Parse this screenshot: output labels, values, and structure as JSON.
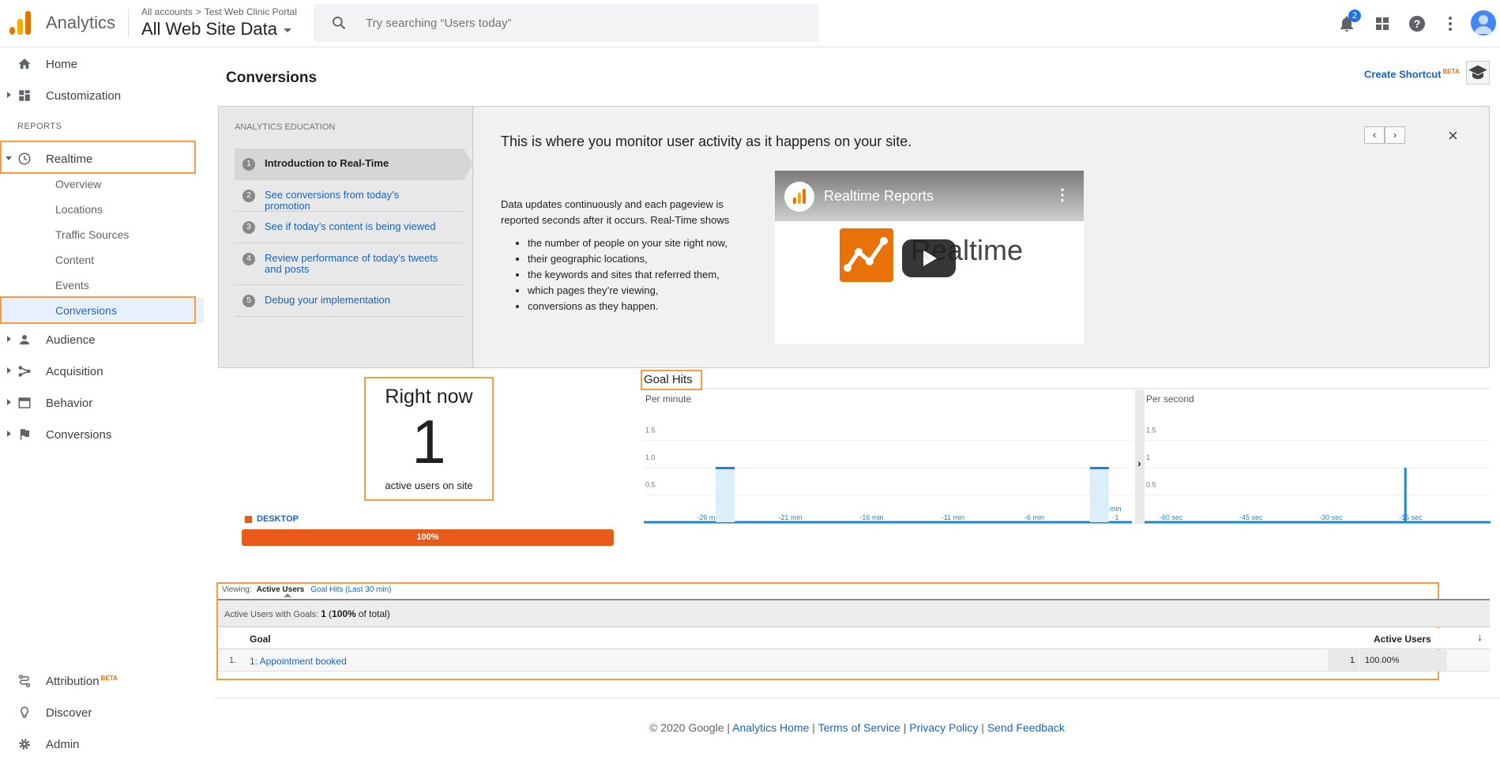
{
  "app": {
    "name": "Analytics",
    "breadcrumb": [
      "All accounts",
      "Test Web Clinic Portal"
    ],
    "view": "All Web Site Data",
    "search_placeholder": "Try searching “Users today”",
    "notifications_count": "2"
  },
  "sidebar": {
    "home": "Home",
    "customization": "Customization",
    "reports_section": "REPORTS",
    "realtime": "Realtime",
    "realtime_items": [
      "Overview",
      "Locations",
      "Traffic Sources",
      "Content",
      "Events",
      "Conversions"
    ],
    "audience": "Audience",
    "acquisition": "Acquisition",
    "behavior": "Behavior",
    "conversions": "Conversions",
    "attribution": "Attribution",
    "attribution_badge": "BETA",
    "discover": "Discover",
    "admin": "Admin"
  },
  "page": {
    "title": "Conversions",
    "create_shortcut": "Create Shortcut",
    "shortcut_badge": "BETA"
  },
  "education": {
    "heading": "ANALYTICS EDUCATION",
    "steps": [
      {
        "num": "1",
        "label": "Introduction to Real-Time"
      },
      {
        "num": "2",
        "label": "See conversions from today’s promotion"
      },
      {
        "num": "3",
        "label": "See if today’s content is being viewed"
      },
      {
        "num": "4",
        "label": "Review performance of today’s tweets and posts"
      },
      {
        "num": "5",
        "label": "Debug your implementation"
      }
    ],
    "headline": "This is where you monitor user activity as it happens on your site.",
    "description": "Data updates continuously and each pageview is reported seconds after it occurs. Real-Time shows",
    "bullets": [
      "the number of people on your site right now,",
      "their geographic locations,",
      "the keywords and sites that referred them,",
      "which pages they’re viewing,",
      "conversions as they happen."
    ],
    "prev": "‹",
    "next": "›",
    "close": "×",
    "video_title": "Realtime Reports",
    "video_word": "Realtime"
  },
  "right_now": {
    "title": "Right now",
    "value": "1",
    "subtitle": "active users on site",
    "device_label": "DESKTOP",
    "device_pct": "100%",
    "device_share": 1.0
  },
  "goal_hits": {
    "title": "Goal Hits",
    "per_minute_label": "Per minute",
    "per_second_label": "Per second",
    "expand": "›"
  },
  "chart_data": [
    {
      "type": "bar",
      "title": "Per minute",
      "x_ticks": [
        "-26 min",
        "-21 min",
        "-16 min",
        "-11 min",
        "-6 min",
        "-1 min"
      ],
      "y_ticks": [
        "0.5",
        "1.0",
        "1.5"
      ],
      "ylim": [
        0,
        2
      ],
      "xlim": [
        -30,
        0
      ],
      "bars": [
        {
          "x": -25,
          "value": 1
        },
        {
          "x": -2,
          "value": 1
        }
      ]
    },
    {
      "type": "bar",
      "title": "Per second",
      "x_ticks": [
        "-60 sec",
        "-45 sec",
        "-30 sec",
        "-15 sec"
      ],
      "y_ticks": [
        "0.5",
        "1",
        "1.5"
      ],
      "ylim": [
        0,
        2
      ],
      "xlim": [
        -65,
        0
      ],
      "bars": [
        {
          "x": -16,
          "value": 1
        }
      ]
    }
  ],
  "table": {
    "viewing_label": "Viewing:",
    "tab_active": "Active Users",
    "tab_other": "Goal Hits (Last 30 min)",
    "summary_label": "Active Users with Goals:",
    "summary_count": "1",
    "summary_pct": "100%",
    "summary_suffix": "of total)",
    "col_goal": "Goal",
    "col_users": "Active Users",
    "rows": [
      {
        "idx": "1.",
        "goal": "1: Appointment booked",
        "users": "1",
        "pct": "100.00%"
      }
    ]
  },
  "footer": {
    "copyright": "© 2020 Google",
    "links": [
      "Analytics Home",
      "Terms of Service",
      "Privacy Policy",
      "Send Feedback"
    ]
  },
  "colors": {
    "accent": "#e37400",
    "highlight": "#f89b3a",
    "link": "#1565c0",
    "bar": "#1a88c9",
    "device": "#e8591a"
  }
}
